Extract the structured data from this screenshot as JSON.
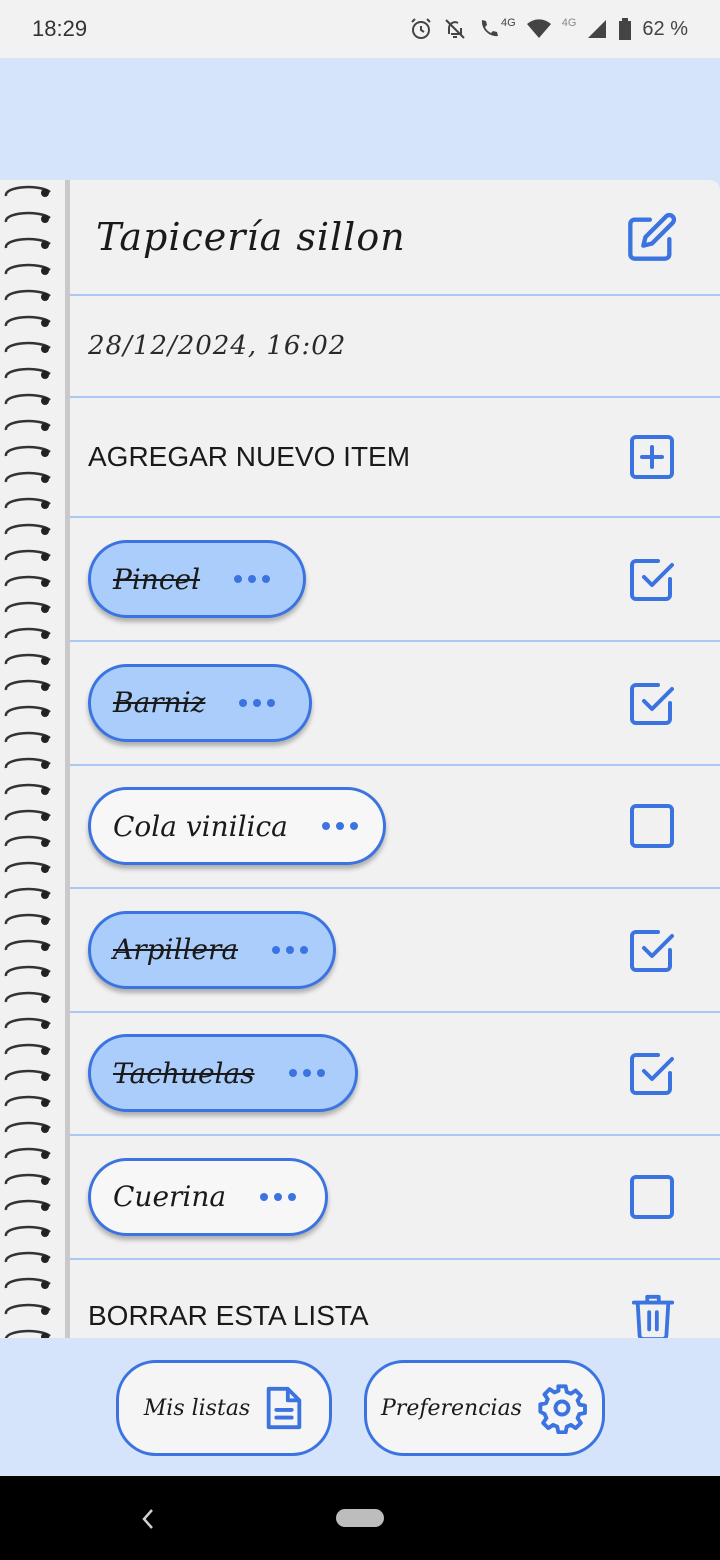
{
  "status_bar": {
    "time": "18:29",
    "net1": "4G",
    "net2": "4G",
    "battery": "62 %",
    "icons": [
      "alarm-icon",
      "notifications-off-icon",
      "call-icon",
      "wifi-icon",
      "signal-icon",
      "battery-icon"
    ]
  },
  "list": {
    "title": "Tapicería sillon",
    "date": "28/12/2024, 16:02",
    "add_item_label": "AGREGAR NUEVO ITEM",
    "delete_label": "BORRAR ESTA LISTA",
    "items": [
      {
        "label": "Pincel",
        "checked": true
      },
      {
        "label": "Barniz",
        "checked": true
      },
      {
        "label": "Cola vinilica",
        "checked": false
      },
      {
        "label": "Arpillera",
        "checked": true
      },
      {
        "label": "Tachuelas",
        "checked": true
      },
      {
        "label": "Cuerina",
        "checked": false
      }
    ]
  },
  "bottom_nav": {
    "my_lists": "Mis listas",
    "preferences": "Preferencias"
  },
  "colors": {
    "accent": "#3b74e0",
    "checked_fill": "#aacdfc",
    "background": "#d5e3fb",
    "paper": "#f1f1f1",
    "rule_line": "#a9c8f5"
  }
}
